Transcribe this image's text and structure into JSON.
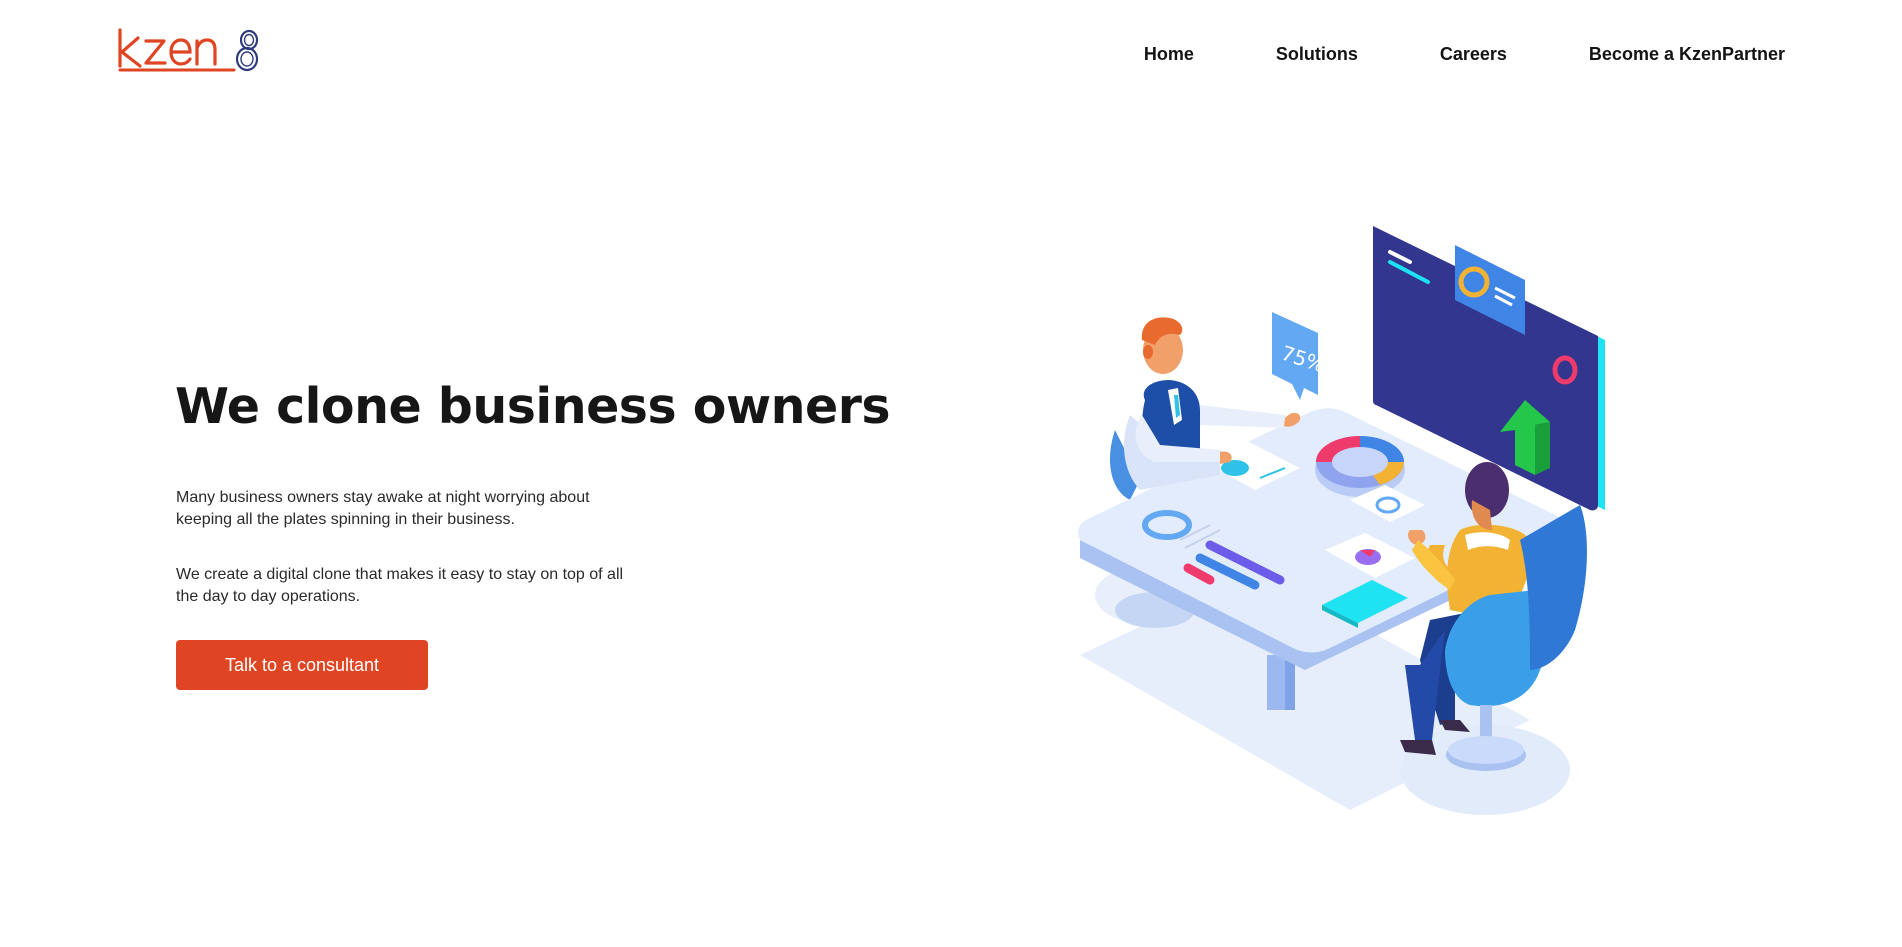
{
  "brand": {
    "logo_text": "kzen8",
    "colors": {
      "accent": "#e04523",
      "logo_eight": "#2e3a7c",
      "text_dark": "#161616"
    }
  },
  "nav": {
    "items": [
      {
        "label": "Home"
      },
      {
        "label": "Solutions"
      },
      {
        "label": "Careers"
      },
      {
        "label": "Become a KzenPartner"
      }
    ]
  },
  "hero": {
    "title": "We clone business owners",
    "paragraph_1": "Many business owners stay awake at night worrying about keeping all the plates spinning in their business.",
    "paragraph_2": "We create a digital clone that makes it easy to stay on top of all the day to day operations.",
    "cta_label": "Talk to a consultant"
  },
  "illustration": {
    "badge_text": "75%",
    "icon": "business-meeting-illustration"
  }
}
